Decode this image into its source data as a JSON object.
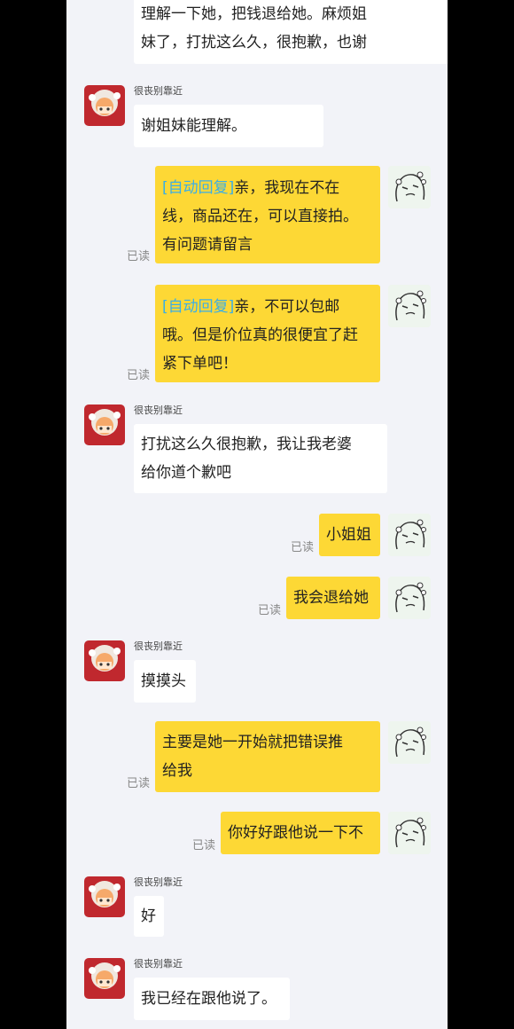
{
  "colors": {
    "page_background": "#f2f3f8",
    "side_bars": "#000000",
    "incoming_bubble": "#ffffff",
    "outgoing_bubble": "#fdd835",
    "auto_reply_tag": "#3aaee6",
    "read_status_text": "#888888"
  },
  "read_label": "已读",
  "sender_name": "很丧别靠近",
  "messages": [
    {
      "side": "in",
      "lines": [
        "理解一下她，把钱退给她。麻烦姐",
        "妹了，打扰这么久，很抱歉，也谢"
      ]
    },
    {
      "side": "in",
      "lines": [
        "谢姐妹能理解。"
      ]
    },
    {
      "side": "out",
      "tag": "[自动回复]",
      "lines": [
        "亲，我现在不在",
        "线，商品还在，可以直接拍。",
        "有问题请留言"
      ]
    },
    {
      "side": "out",
      "tag": "[自动回复]",
      "lines": [
        "亲，不可以包邮",
        "哦。但是价位真的很便宜了赶",
        "紧下单吧！"
      ]
    },
    {
      "side": "in",
      "lines": [
        "打扰这么久很抱歉，我让我老婆",
        "给你道个歉吧"
      ]
    },
    {
      "side": "out",
      "lines": [
        "小姐姐"
      ]
    },
    {
      "side": "out",
      "lines": [
        "我会退给她"
      ]
    },
    {
      "side": "in",
      "lines": [
        "摸摸头"
      ]
    },
    {
      "side": "out",
      "lines": [
        "主要是她一开始就把错误推",
        "给我"
      ]
    },
    {
      "side": "out",
      "lines": [
        "你好好跟他说一下不"
      ]
    },
    {
      "side": "in",
      "lines": [
        "好"
      ]
    },
    {
      "side": "in",
      "lines": [
        "我已经在跟他说了。"
      ]
    }
  ]
}
